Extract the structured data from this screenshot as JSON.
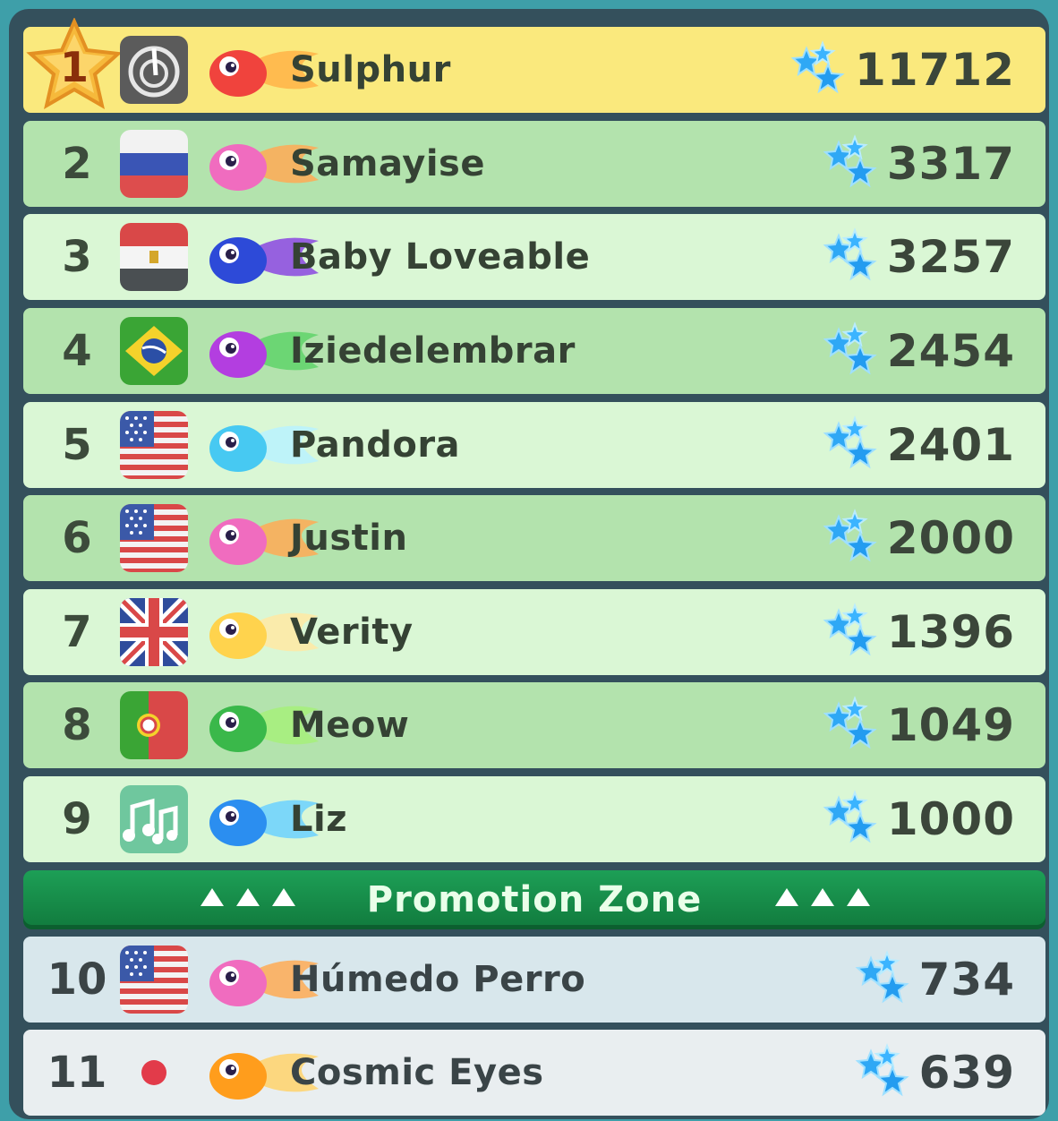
{
  "leaderboard": {
    "entries": [
      {
        "rank": "1",
        "name": "Sulphur",
        "score": "11712",
        "flag": "swirl-icon",
        "fish": "red-fish"
      },
      {
        "rank": "2",
        "name": "Samayise",
        "score": "3317",
        "flag": "russia-flag",
        "fish": "pink-fish"
      },
      {
        "rank": "3",
        "name": "Baby Loveable",
        "score": "3257",
        "flag": "egypt-flag",
        "fish": "blue-galaxy-fish"
      },
      {
        "rank": "4",
        "name": "Iziedelembrar",
        "score": "2454",
        "flag": "brazil-flag",
        "fish": "purple-green-fish"
      },
      {
        "rank": "5",
        "name": "Pandora",
        "score": "2401",
        "flag": "usa-flag",
        "fish": "cyan-fish"
      },
      {
        "rank": "6",
        "name": "Justin",
        "score": "2000",
        "flag": "usa-flag",
        "fish": "pink-fish"
      },
      {
        "rank": "7",
        "name": "Verity",
        "score": "1396",
        "flag": "uk-flag",
        "fish": "yellow-fish"
      },
      {
        "rank": "8",
        "name": "Meow",
        "score": "1049",
        "flag": "portugal-flag",
        "fish": "green-fish"
      },
      {
        "rank": "9",
        "name": "Liz",
        "score": "1000",
        "flag": "music-notes-icon",
        "fish": "blue-fish"
      },
      {
        "rank": "10",
        "name": "Húmedo Perro",
        "score": "734",
        "flag": "usa-flag",
        "fish": "pink-fish"
      },
      {
        "rank": "11",
        "name": "Cosmic Eyes",
        "score": "639",
        "flag": "japan-flag",
        "fish": "orange-fish"
      }
    ]
  },
  "promotion": {
    "label": "Promotion Zone"
  },
  "colors": {
    "first": "#fae97d",
    "row_dark": "#b3e3ad",
    "row_light": "#daf7d5",
    "promo_green": "#1d9f56",
    "gem_blue": "#2fa8f5"
  }
}
